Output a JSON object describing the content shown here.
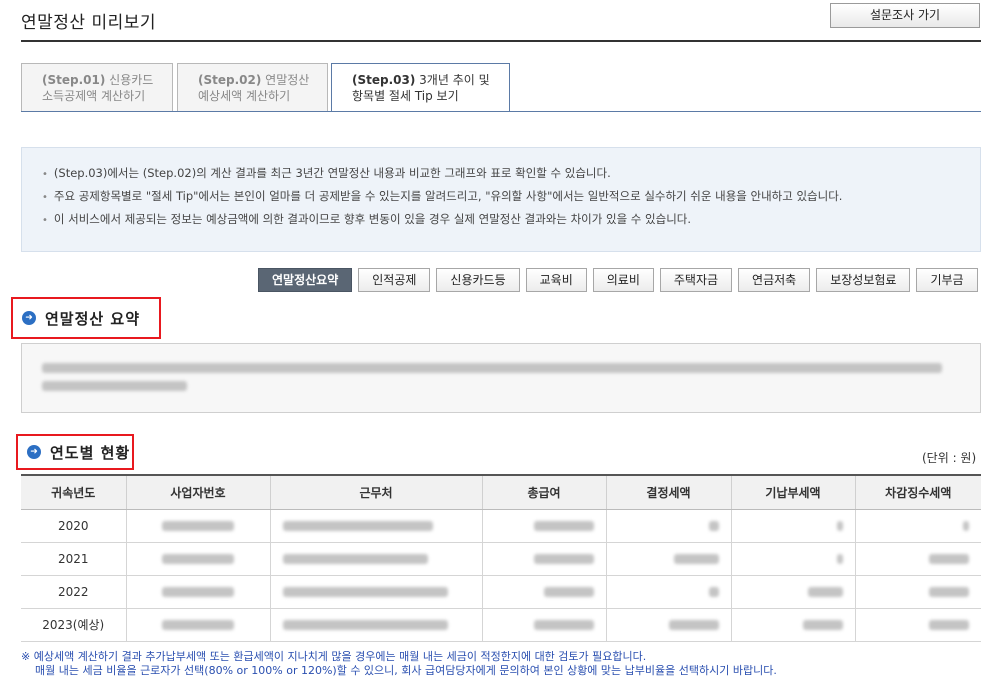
{
  "page": {
    "title": "연말정산 미리보기",
    "survey_button": "설문조사 가기"
  },
  "tabs": [
    {
      "step": "(Step.01)",
      "line1": "신용카드",
      "line2": "소득공제액 계산하기",
      "active": false
    },
    {
      "step": "(Step.02)",
      "line1": "연말정산",
      "line2": "예상세액 계산하기",
      "active": false
    },
    {
      "step": "(Step.03)",
      "line1": "3개년 추이 및",
      "line2": "항목별 절세 Tip 보기",
      "active": true
    }
  ],
  "info_lines": [
    "(Step.03)에서는 (Step.02)의 계산 결과를 최근 3년간 연말정산 내용과 비교한 그래프와 표로 확인할 수 있습니다.",
    "주요 공제항목별로 \"절세 Tip\"에서는 본인이 얼마를 더 공제받을 수 있는지를 알려드리고, \"유의할 사항\"에서는 일반적으로 실수하기 쉬운 내용을 안내하고 있습니다.",
    "이 서비스에서 제공되는 정보는 예상금액에 의한 결과이므로 향후 변동이 있을 경우 실제 연말정산 결과와는 차이가 있을 수 있습니다."
  ],
  "filters": [
    {
      "label": "연말정산요약",
      "active": true
    },
    {
      "label": "인적공제",
      "active": false
    },
    {
      "label": "신용카드등",
      "active": false
    },
    {
      "label": "교육비",
      "active": false
    },
    {
      "label": "의료비",
      "active": false
    },
    {
      "label": "주택자금",
      "active": false
    },
    {
      "label": "연금저축",
      "active": false
    },
    {
      "label": "보장성보험료",
      "active": false
    },
    {
      "label": "기부금",
      "active": false
    }
  ],
  "summary_section": {
    "title": "연말정산 요약"
  },
  "yearly_section": {
    "title": "연도별 현황",
    "unit": "(단위 : 원)"
  },
  "table": {
    "headers": [
      "귀속년도",
      "사업자번호",
      "근무처",
      "총급여",
      "결정세액",
      "기납부세액",
      "차감징수세액"
    ],
    "years": [
      "2020",
      "2021",
      "2022",
      "2023(예상)"
    ]
  },
  "notes": [
    "※ 예상세액 계산하기 결과 추가납부세액 또는 환급세액이 지나치게 많을 경우에는 매월 내는 세금이 적정한지에 대한 검토가 필요합니다.",
    "매월 내는 세금 비율을 근로자가 선택(80% or 100% or 120%)할 수 있으니, 회사 급여담당자에게 문의하여 본인 상황에 맞는 납부비율을 선택하시기 바랍니다."
  ],
  "colors": {
    "section_highlight": "#e8191f",
    "active_filter": "#5a6674",
    "note_text": "#2a4fb0",
    "section_icon": "#2c6fc3"
  }
}
